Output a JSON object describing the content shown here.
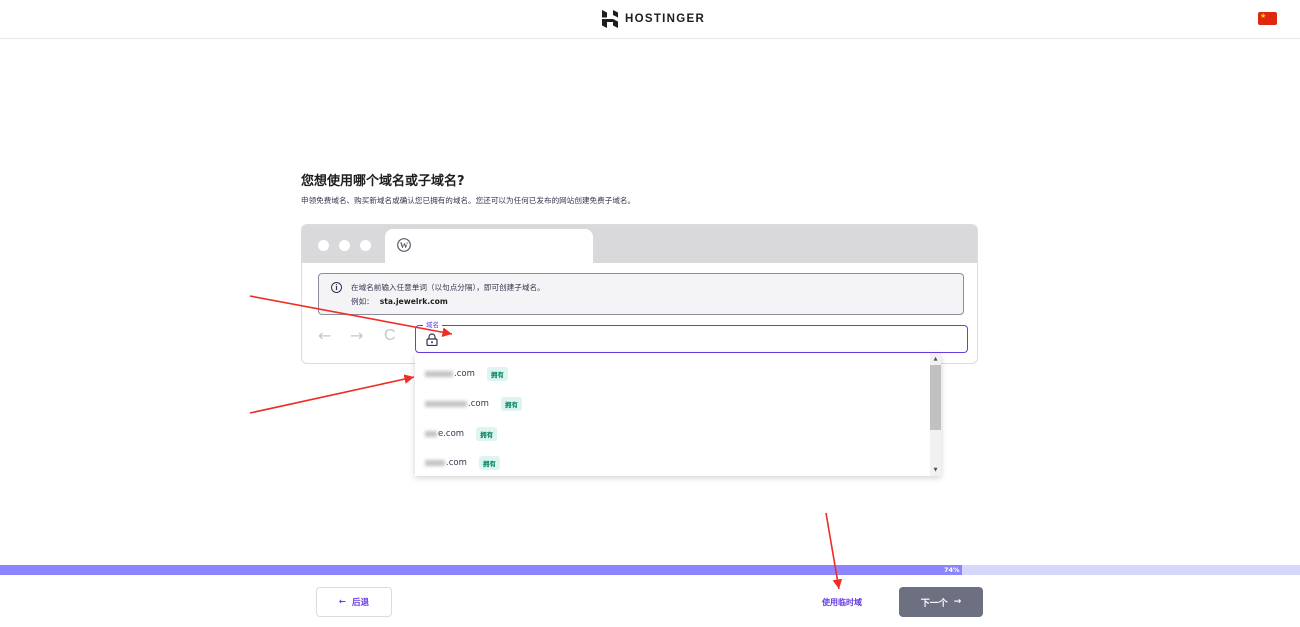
{
  "header": {
    "brand": "HOSTINGER",
    "logo_icon": "hostinger-logo-icon",
    "language_flag_icon": "china-flag-icon"
  },
  "main": {
    "title": "您想使用哪个域名或子域名?",
    "subtitle": "申领免费域名、购买新域名或确认您已拥有的域名。您还可以为任何已发布的网站创建免费子域名。"
  },
  "browser_mock": {
    "info_text": "在域名前输入任意单词（以句点分隔），即可创建子域名。",
    "example_label": "例如：",
    "example_value": "sta.jewelrk.com",
    "back_arrow": "←",
    "forward_arrow": "→",
    "reload": "C"
  },
  "domain_input": {
    "label": "域名",
    "value": ""
  },
  "dropdown": {
    "items": [
      {
        "suffix": ".com",
        "badge": "拥有"
      },
      {
        "suffix": ".com",
        "badge": "拥有"
      },
      {
        "suffix": "e.com",
        "badge": "拥有"
      },
      {
        "suffix": ".com",
        "badge": "拥有"
      }
    ]
  },
  "progress": {
    "percent": 74,
    "label": "74%"
  },
  "footer": {
    "back_label": "后退",
    "back_arrow": "←",
    "temp_domain_link": "使用临时域",
    "next_label": "下一个",
    "next_arrow": "→"
  },
  "colors": {
    "accent": "#673de6",
    "progress_fill": "#8c85ff",
    "progress_track": "#d5d8fb",
    "badge_bg": "#def4f0",
    "badge_text": "#008361",
    "next_button": "#6d7081",
    "annotation_arrow": "#ee2d24"
  }
}
